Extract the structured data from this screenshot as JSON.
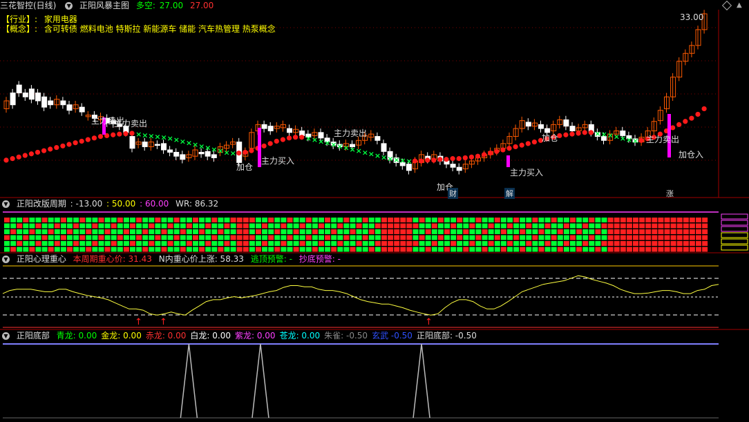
{
  "main_header": {
    "app": "三花智控(日线)",
    "indicator": "正阳风暴主图",
    "duo_label": "多空:",
    "duo_val1": "27.00",
    "duo_val2": "27.00"
  },
  "info": {
    "industry_label": "【行业】:",
    "industry": "家用电器",
    "concept_label": "【概念】:",
    "concept": "含可转债 燃料电池 特斯拉 新能源车 储能 汽车热管理 热泵概念"
  },
  "price_label": "33.00",
  "panel2_header": {
    "name": "正阳改版周期",
    "v1": ": -13.00",
    "v2": ": 50.00",
    "v3": ": 60.00",
    "wr": "WR: 86.32"
  },
  "panel3_header": {
    "name": "正阳心理重心",
    "a_label": "本周期重心价: 31.43",
    "b_label": "N内重心价上涨: 58.33",
    "c_label": "逃顶预警: -",
    "d_label": "抄底预警: -"
  },
  "panel4_header": {
    "name": "正阳底部",
    "items": [
      {
        "label": "青龙:",
        "val": "0.00",
        "color": "#00ff00"
      },
      {
        "label": "金龙:",
        "val": "0.00",
        "color": "#ffff00"
      },
      {
        "label": "赤龙:",
        "val": "0.00",
        "color": "#ff3030"
      },
      {
        "label": "白龙:",
        "val": "0.00",
        "color": "#ffffff"
      },
      {
        "label": "紫龙:",
        "val": "0.00",
        "color": "#ff40ff"
      },
      {
        "label": "苍龙:",
        "val": "0.00",
        "color": "#00ffff"
      },
      {
        "label": "朱雀:",
        "val": "-0.50",
        "color": "#888888"
      },
      {
        "label": "玄武",
        "val": "-0.50",
        "color": "#3050ff"
      },
      {
        "label": "正阳底部:",
        "val": "-0.50",
        "color": "#dddddd"
      }
    ]
  },
  "annotations": [
    {
      "text": "主力卖出",
      "color": "#ffff60"
    },
    {
      "text": "主力卖出",
      "color": "#ffff60"
    },
    {
      "text": "加仓",
      "color": "#ffff60"
    },
    {
      "text": "主力买入",
      "color": "#ffff60"
    },
    {
      "text": "主力卖出",
      "color": "#ffff60"
    },
    {
      "text": "加仓",
      "color": "#ffff60"
    },
    {
      "text": "财",
      "color": "#66ccff"
    },
    {
      "text": "解",
      "color": "#66ccff"
    },
    {
      "text": "加仓",
      "color": "#ffff60"
    },
    {
      "text": "主力买入",
      "color": "#ffff60"
    },
    {
      "text": "主力卖出",
      "color": "#ffff60"
    },
    {
      "text": "加仓入",
      "color": "#ffff60"
    },
    {
      "text": "涨",
      "color": "#ff4040"
    }
  ],
  "chart_data": {
    "type": "line",
    "candles": [
      [
        10,
        11
      ],
      [
        12,
        10.5
      ],
      [
        13,
        12
      ],
      [
        12,
        11.5
      ],
      [
        12.5,
        11.2
      ],
      [
        12,
        11
      ],
      [
        11.5,
        10.2
      ],
      [
        11,
        10.5
      ],
      [
        10.5,
        11.2
      ],
      [
        11,
        10.5
      ],
      [
        10.5,
        9.8
      ],
      [
        10,
        10.5
      ],
      [
        10.2,
        9.6
      ],
      [
        9,
        9.2
      ],
      [
        9.2,
        8.8
      ],
      [
        8.6,
        9
      ],
      [
        8.8,
        8.2
      ],
      [
        8.5,
        8.1
      ],
      [
        8,
        7.8
      ],
      [
        7.8,
        7
      ],
      [
        6.5,
        5
      ],
      [
        5.5,
        5.8
      ],
      [
        5.8,
        5.2
      ],
      [
        5.2,
        5.8
      ],
      [
        5.5,
        5.4
      ],
      [
        5.6,
        4.8
      ],
      [
        4.8,
        4.5
      ],
      [
        4.5,
        4
      ],
      [
        4.2,
        3.6
      ],
      [
        3.8,
        4.2
      ],
      [
        4,
        4.8
      ],
      [
        4.5,
        4.3
      ],
      [
        4.6,
        4
      ],
      [
        4.2,
        3.8
      ],
      [
        4.5,
        5.2
      ],
      [
        5,
        5.4
      ],
      [
        5.5,
        5.8
      ],
      [
        5.8,
        3.2
      ],
      [
        4,
        4.6
      ],
      [
        5,
        7
      ],
      [
        7.2,
        8
      ],
      [
        8,
        7.5
      ],
      [
        7.8,
        7.2
      ],
      [
        7.5,
        7.8
      ],
      [
        7.6,
        8
      ],
      [
        7.5,
        7
      ],
      [
        7,
        7.4
      ],
      [
        7.2,
        6.6
      ],
      [
        6.8,
        6.4
      ],
      [
        6.6,
        7
      ],
      [
        7,
        6.3
      ],
      [
        6.3,
        5.8
      ],
      [
        5.8,
        5.4
      ],
      [
        5.5,
        5.2
      ],
      [
        5.2,
        5.6
      ],
      [
        5.5,
        5.2
      ],
      [
        5.4,
        6
      ],
      [
        6,
        6.6
      ],
      [
        6.4,
        6.8
      ],
      [
        6.5,
        6
      ],
      [
        5.6,
        4.6
      ],
      [
        4.6,
        3.6
      ],
      [
        3.8,
        3.2
      ],
      [
        3.2,
        2.8
      ],
      [
        3,
        2.2
      ],
      [
        2.4,
        3.4
      ],
      [
        3.2,
        4.2
      ],
      [
        4,
        3.6
      ],
      [
        3.6,
        4.2
      ],
      [
        4,
        3.4
      ],
      [
        3.4,
        3
      ],
      [
        3,
        2.6
      ],
      [
        2.6,
        2.2
      ],
      [
        2.4,
        3
      ],
      [
        3,
        3.4
      ],
      [
        3.4,
        3.8
      ],
      [
        3.8,
        4.2
      ],
      [
        4.2,
        4.6
      ],
      [
        4.6,
        5
      ],
      [
        5,
        5.6
      ],
      [
        5.6,
        6.5
      ],
      [
        6.5,
        7.5
      ],
      [
        7.5,
        8.5
      ],
      [
        8.3,
        7.8
      ],
      [
        7.8,
        8.2
      ],
      [
        8,
        7.5
      ],
      [
        7.5,
        7
      ],
      [
        7.2,
        8
      ],
      [
        8,
        8.6
      ],
      [
        8.6,
        7.8
      ],
      [
        7.8,
        7.2
      ],
      [
        7.2,
        7.6
      ],
      [
        7.6,
        8
      ],
      [
        8,
        7
      ],
      [
        7,
        6.5
      ],
      [
        6.5,
        6
      ],
      [
        6,
        6.8
      ],
      [
        6.8,
        7.2
      ],
      [
        7.2,
        6.6
      ],
      [
        6.6,
        6.2
      ],
      [
        6.2,
        5.8
      ],
      [
        5.8,
        6.4
      ],
      [
        6.4,
        7.2
      ],
      [
        7.2,
        8.4
      ],
      [
        8.5,
        9.8
      ],
      [
        10,
        11.5
      ],
      [
        11.5,
        14
      ],
      [
        14,
        16
      ],
      [
        16,
        17
      ],
      [
        17,
        18
      ],
      [
        18,
        20
      ],
      [
        20,
        22
      ]
    ],
    "support_line": [
      3.5,
      3.7,
      3.9,
      4.1,
      4.3,
      4.5,
      4.7,
      4.9,
      5.1,
      5.3,
      5.5,
      5.7,
      5.9,
      6.1,
      6.3,
      6.5,
      6.6,
      6.7,
      6.8,
      6.85,
      6.9,
      6.8,
      6.7,
      6.6,
      6.5,
      6.4,
      6.3,
      6.1,
      5.9,
      5.7,
      5.5,
      5.3,
      5.1,
      4.9,
      4.7,
      4.5,
      4.4,
      4.4,
      4.5,
      4.7,
      5,
      5.3,
      5.6,
      5.9,
      6.1,
      6.3,
      6.4,
      6.4,
      6.3,
      6.1,
      5.9,
      5.7,
      5.5,
      5.3,
      5.1,
      4.9,
      4.7,
      4.5,
      4.3,
      4.1,
      3.9,
      3.7,
      3.6,
      3.5,
      3.4,
      3.4,
      3.4,
      3.5,
      3.5,
      3.6,
      3.6,
      3.7,
      3.7,
      3.8,
      3.9,
      4,
      4.2,
      4.4,
      4.6,
      4.8,
      5,
      5.2,
      5.4,
      5.6,
      5.8,
      6,
      6.2,
      6.4,
      6.6,
      6.7,
      6.8,
      6.9,
      7,
      7,
      6.9,
      6.8,
      6.7,
      6.5,
      6.3,
      6.1,
      6,
      6,
      6.2,
      6.4,
      6.8,
      7.2,
      7.6,
      8,
      8.4,
      8.8,
      9.3,
      10
    ],
    "xlabel": "",
    "ylabel": ""
  },
  "heart_line": [
    0.55,
    0.6,
    0.62,
    0.62,
    0.62,
    0.6,
    0.58,
    0.58,
    0.62,
    0.62,
    0.58,
    0.55,
    0.52,
    0.5,
    0.48,
    0.45,
    0.4,
    0.35,
    0.3,
    0.3,
    0.28,
    0.22,
    0.2,
    0.22,
    0.25,
    0.22,
    0.2,
    0.28,
    0.35,
    0.42,
    0.45,
    0.45,
    0.48,
    0.5,
    0.48,
    0.5,
    0.52,
    0.55,
    0.58,
    0.6,
    0.65,
    0.68,
    0.68,
    0.66,
    0.66,
    0.62,
    0.6,
    0.6,
    0.58,
    0.55,
    0.5,
    0.45,
    0.42,
    0.4,
    0.38,
    0.38,
    0.35,
    0.32,
    0.28,
    0.25,
    0.22,
    0.2,
    0.22,
    0.32,
    0.4,
    0.45,
    0.45,
    0.42,
    0.35,
    0.3,
    0.3,
    0.35,
    0.42,
    0.5,
    0.58,
    0.62,
    0.66,
    0.7,
    0.72,
    0.74,
    0.76,
    0.8,
    0.84,
    0.82,
    0.78,
    0.75,
    0.72,
    0.68,
    0.62,
    0.58,
    0.55,
    0.55,
    0.56,
    0.58,
    0.6,
    0.6,
    0.58,
    0.55,
    0.55,
    0.6,
    0.62,
    0.68,
    0.7
  ],
  "dragon_spikes": [
    0.26,
    0.36,
    0.585
  ],
  "colors": {
    "up": "#ff5a00",
    "down": "#ffffff",
    "support_red": "#ff1a1a",
    "support_green": "#00ff40",
    "heart": "#ffff40"
  }
}
